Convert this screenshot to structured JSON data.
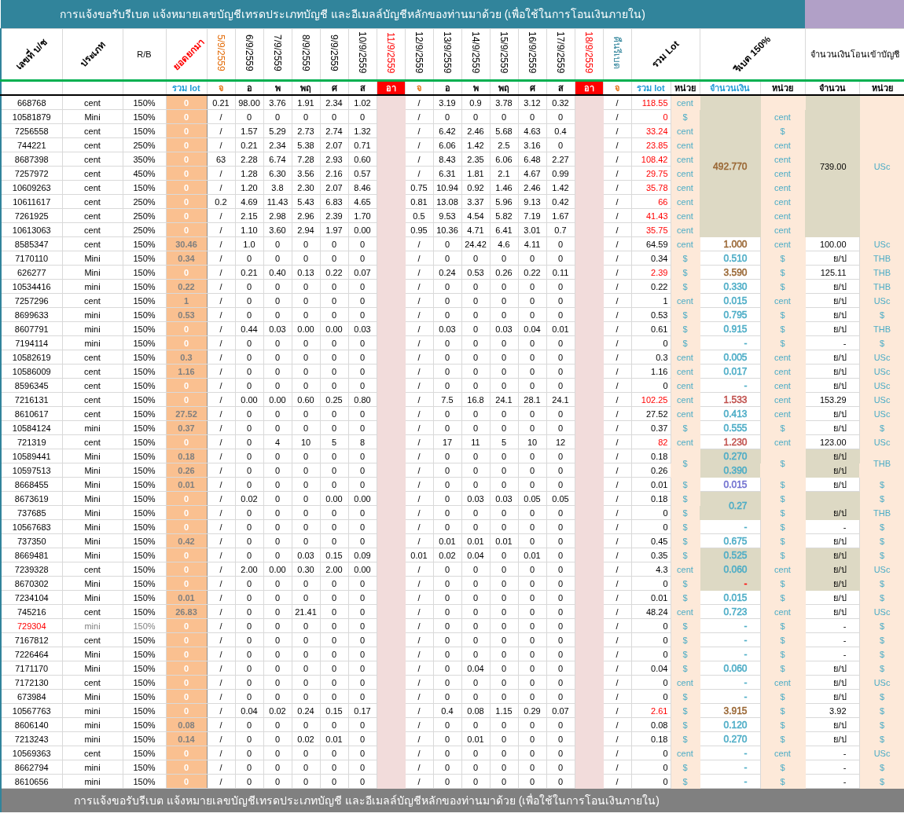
{
  "title": "การแจ้งขอรับรีเบต   แจ้งหมายเลขบัญชีเทรดประเภทบัญชี และอีเมลล์บัญชีหลักของท่านมาด้วย   (เพื่อใช้ในการโอนเงินภายใน)",
  "header_groups": [
    {
      "label": "เลขที่ บ/ช",
      "kind": "account",
      "holiday": false
    },
    {
      "label": "ประเภท",
      "kind": "type",
      "holiday": false
    },
    {
      "label": "R/B",
      "kind": "rb",
      "holiday": false
    },
    {
      "label": "ยอดยกมา",
      "kind": "carried",
      "color": "#ff0000",
      "holiday": false,
      "subs": [
        {
          "label": "รวม lot",
          "color": "#1f9ad6"
        }
      ]
    },
    {
      "label": "5/9/2559",
      "kind": "day",
      "color": "#e36c09",
      "holiday": false,
      "subs": [
        {
          "label": "จ",
          "color": "#e36c09"
        }
      ]
    },
    {
      "label": "6/9/2559",
      "kind": "day",
      "holiday": false,
      "subs": [
        {
          "label": "อ"
        }
      ]
    },
    {
      "label": "7/9/2559",
      "kind": "day",
      "holiday": false,
      "subs": [
        {
          "label": "พ"
        }
      ]
    },
    {
      "label": "8/9/2559",
      "kind": "day",
      "holiday": false,
      "subs": [
        {
          "label": "พฤ"
        }
      ]
    },
    {
      "label": "9/9/2559",
      "kind": "day",
      "holiday": false,
      "subs": [
        {
          "label": "ศ"
        }
      ]
    },
    {
      "label": "10/9/2559",
      "kind": "day",
      "holiday": false,
      "subs": [
        {
          "label": "ส"
        }
      ]
    },
    {
      "label": "11/9/2559",
      "kind": "day",
      "color": "#ff0000",
      "holiday": true,
      "subs": [
        {
          "label": "อา"
        }
      ]
    },
    {
      "label": "12/9/2559",
      "kind": "day",
      "holiday": false,
      "subs": [
        {
          "label": "จ",
          "color": "#e36c09"
        }
      ]
    },
    {
      "label": "13/9/2559",
      "kind": "day",
      "holiday": false,
      "subs": [
        {
          "label": "อ"
        }
      ]
    },
    {
      "label": "14/9/2559",
      "kind": "day",
      "holiday": false,
      "subs": [
        {
          "label": "พ"
        }
      ]
    },
    {
      "label": "15/9/2559",
      "kind": "day",
      "holiday": false,
      "subs": [
        {
          "label": "พฤ"
        }
      ]
    },
    {
      "label": "16/9/2559",
      "kind": "day",
      "holiday": false,
      "subs": [
        {
          "label": "ศ"
        }
      ]
    },
    {
      "label": "17/9/2559",
      "kind": "day",
      "holiday": false,
      "subs": [
        {
          "label": "ส"
        }
      ]
    },
    {
      "label": "18/9/2559",
      "kind": "day",
      "color": "#ff0000",
      "holiday": true,
      "subs": [
        {
          "label": "อา"
        }
      ]
    },
    {
      "label": "คืนรีเบต",
      "kind": "day",
      "color": "#31849b",
      "holiday": false,
      "subs": [
        {
          "label": "จ",
          "color": "#e36c09"
        }
      ]
    },
    {
      "label": "รวม Lot",
      "kind": "lot",
      "holiday": false,
      "subs": [
        {
          "label": "รวม lot",
          "color": "#1f9ad6"
        },
        {
          "label": "หน่วย"
        }
      ]
    },
    {
      "label": "รีเบต 150%",
      "kind": "rebate",
      "holiday": false,
      "subs": [
        {
          "label": "จำนวนเงิน",
          "color": "#1f9ad6"
        },
        {
          "label": "หน่วย"
        }
      ]
    },
    {
      "label": "จำนวนเงินโอนเข้าบัญชี",
      "kind": "transfer",
      "holiday": false,
      "subs": [
        {
          "label": "จำนวน"
        },
        {
          "label": "หน่วย"
        }
      ]
    }
  ],
  "rows": [
    {
      "kind": "group",
      "shaded": true,
      "amount": {
        "text": "492.770",
        "color": "#996633"
      },
      "transfer": "739.00",
      "transfer_unit": "USc",
      "rows": [
        {
          "account": "668768",
          "type": "cent",
          "rb": "150%",
          "carried": "0",
          "carried_faint": true,
          "flagged": false,
          "days": [
            "0.21",
            "98.00",
            "3.76",
            "1.91",
            "2.34",
            "1.02",
            "/",
            "3.19",
            "0.9",
            "3.78",
            "3.12",
            "0.32",
            "/"
          ],
          "total": "118.55",
          "total_alert": true,
          "lot_unit": "cent"
        },
        {
          "account": "10581879",
          "type": "Mini",
          "rb": "150%",
          "carried": "0",
          "carried_faint": true,
          "flagged": false,
          "days": [
            "/",
            "0",
            "0",
            "0",
            "0",
            "0",
            "/",
            "0",
            "0",
            "0",
            "0",
            "0",
            "/"
          ],
          "total": "0",
          "total_alert": true,
          "lot_unit": "$",
          "amount_unit": "cent"
        },
        {
          "account": "7256558",
          "type": "cent",
          "rb": "150%",
          "carried": "0",
          "carried_faint": true,
          "flagged": false,
          "days": [
            "/",
            "1.57",
            "5.29",
            "2.73",
            "2.74",
            "1.32",
            "/",
            "6.42",
            "2.46",
            "5.68",
            "4.63",
            "0.4",
            "/"
          ],
          "total": "33.24",
          "total_alert": true,
          "lot_unit": "cent",
          "amount_unit": "$"
        },
        {
          "account": "744221",
          "type": "cent",
          "rb": "250%",
          "carried": "0",
          "carried_faint": true,
          "flagged": false,
          "days": [
            "/",
            "0.21",
            "2.34",
            "5.38",
            "2.07",
            "0.71",
            "/",
            "6.06",
            "1.42",
            "2.5",
            "3.16",
            "0",
            "/"
          ],
          "total": "23.85",
          "total_alert": true,
          "lot_unit": "cent",
          "amount_unit": "cent"
        },
        {
          "account": "8687398",
          "type": "cent",
          "rb": "350%",
          "carried": "0",
          "carried_faint": true,
          "flagged": false,
          "days": [
            "63",
            "2.28",
            "6.74",
            "7.28",
            "2.93",
            "0.60",
            "/",
            "8.43",
            "2.35",
            "6.06",
            "6.48",
            "2.27",
            "/"
          ],
          "total": "108.42",
          "total_alert": true,
          "lot_unit": "cent",
          "amount_unit": "cent"
        },
        {
          "account": "7257972",
          "type": "cent",
          "rb": "450%",
          "carried": "0",
          "carried_faint": true,
          "flagged": false,
          "days": [
            "/",
            "1.28",
            "6.30",
            "3.56",
            "2.16",
            "0.57",
            "/",
            "6.31",
            "1.81",
            "2.1",
            "4.67",
            "0.99",
            "/"
          ],
          "total": "29.75",
          "total_alert": true,
          "lot_unit": "cent",
          "amount_unit": "cent"
        },
        {
          "account": "10609263",
          "type": "cent",
          "rb": "150%",
          "carried": "0",
          "carried_faint": true,
          "flagged": false,
          "days": [
            "/",
            "1.20",
            "3.8",
            "2.30",
            "2.07",
            "8.46",
            "0.75",
            "10.94",
            "0.92",
            "1.46",
            "2.46",
            "1.42",
            "/"
          ],
          "total": "35.78",
          "total_alert": true,
          "lot_unit": "cent",
          "amount_unit": "cent"
        },
        {
          "account": "10611617",
          "type": "cent",
          "rb": "250%",
          "carried": "0",
          "carried_faint": true,
          "flagged": false,
          "days": [
            "0.2",
            "4.69",
            "11.43",
            "5.43",
            "6.83",
            "4.65",
            "0.81",
            "13.08",
            "3.37",
            "5.96",
            "9.13",
            "0.42",
            "/"
          ],
          "total": "66",
          "total_alert": true,
          "lot_unit": "cent",
          "amount_unit": "cent"
        },
        {
          "account": "7261925",
          "type": "cent",
          "rb": "250%",
          "carried": "0",
          "carried_faint": true,
          "flagged": false,
          "days": [
            "/",
            "2.15",
            "2.98",
            "2.96",
            "2.39",
            "1.70",
            "0.5",
            "9.53",
            "4.54",
            "5.82",
            "7.19",
            "1.67",
            "/"
          ],
          "total": "41.43",
          "total_alert": true,
          "lot_unit": "cent",
          "amount_unit": "cent"
        },
        {
          "account": "10613063",
          "type": "cent",
          "rb": "250%",
          "carried": "0",
          "carried_faint": true,
          "flagged": false,
          "days": [
            "/",
            "1.10",
            "3.60",
            "2.94",
            "1.97",
            "0.00",
            "0.95",
            "10.36",
            "4.71",
            "6.41",
            "3.01",
            "0.7",
            "/"
          ],
          "total": "35.75",
          "total_alert": true,
          "lot_unit": "cent",
          "amount_unit": "cent"
        }
      ]
    },
    {
      "kind": "row",
      "account": "8585347",
      "type": "cent",
      "rb": "150%",
      "carried": "30.46",
      "carried_faint": false,
      "flagged": false,
      "days": [
        "/",
        "1.0",
        "0",
        "0",
        "0",
        "0",
        "/",
        "0",
        "24.42",
        "4.6",
        "4.11",
        "0",
        "/"
      ],
      "total": "64.59",
      "total_alert": false,
      "shaded": false,
      "lot_unit": "cent",
      "amount": {
        "text": "1.000",
        "color": "#996633"
      },
      "amount_unit": "cent",
      "transfer": "100.00",
      "transfer_unit": "USc"
    },
    {
      "kind": "row",
      "account": "7170110",
      "type": "Mini",
      "rb": "150%",
      "carried": "0.34",
      "carried_faint": false,
      "flagged": false,
      "days": [
        "/",
        "0",
        "0",
        "0",
        "0",
        "0",
        "/",
        "0",
        "0",
        "0",
        "0",
        "0",
        "/"
      ],
      "total": "0.34",
      "total_alert": false,
      "shaded": false,
      "lot_unit": "$",
      "amount": {
        "text": "0.510",
        "color": "#4bacc6"
      },
      "amount_unit": "$",
      "transfer": "ย/ป",
      "transfer_unit": "THB"
    },
    {
      "kind": "row",
      "account": "626277",
      "type": "Mini",
      "rb": "150%",
      "carried": "0",
      "carried_faint": true,
      "flagged": false,
      "days": [
        "/",
        "0.21",
        "0.40",
        "0.13",
        "0.22",
        "0.07",
        "/",
        "0.24",
        "0.53",
        "0.26",
        "0.22",
        "0.11",
        "/"
      ],
      "total": "2.39",
      "total_alert": true,
      "shaded": false,
      "lot_unit": "$",
      "amount": {
        "text": "3.590",
        "color": "#996633"
      },
      "amount_unit": "$",
      "transfer": "125.11",
      "transfer_unit": "THB"
    },
    {
      "kind": "row",
      "account": "10534416",
      "type": "mini",
      "rb": "150%",
      "carried": "0.22",
      "carried_faint": false,
      "flagged": false,
      "days": [
        "/",
        "0",
        "0",
        "0",
        "0",
        "0",
        "/",
        "0",
        "0",
        "0",
        "0",
        "0",
        "/"
      ],
      "total": "0.22",
      "total_alert": false,
      "shaded": false,
      "lot_unit": "$",
      "amount": {
        "text": "0.330",
        "color": "#4bacc6"
      },
      "amount_unit": "$",
      "transfer": "ย/ป",
      "transfer_unit": "THB"
    },
    {
      "kind": "row",
      "account": "7257296",
      "type": "cent",
      "rb": "150%",
      "carried": "1",
      "carried_faint": false,
      "flagged": false,
      "days": [
        "/",
        "0",
        "0",
        "0",
        "0",
        "0",
        "/",
        "0",
        "0",
        "0",
        "0",
        "0",
        "/"
      ],
      "total": "1",
      "total_alert": false,
      "shaded": false,
      "lot_unit": "cent",
      "amount": {
        "text": "0.015",
        "color": "#4bacc6"
      },
      "amount_unit": "cent",
      "transfer": "ย/ป",
      "transfer_unit": "USc"
    },
    {
      "kind": "row",
      "account": "8699633",
      "type": "mini",
      "rb": "150%",
      "carried": "0.53",
      "carried_faint": false,
      "flagged": false,
      "days": [
        "/",
        "0",
        "0",
        "0",
        "0",
        "0",
        "/",
        "0",
        "0",
        "0",
        "0",
        "0",
        "/"
      ],
      "total": "0.53",
      "total_alert": false,
      "shaded": false,
      "lot_unit": "$",
      "amount": {
        "text": "0.795",
        "color": "#4bacc6"
      },
      "amount_unit": "$",
      "transfer": "ย/ป",
      "transfer_unit": "$"
    },
    {
      "kind": "row",
      "account": "8607791",
      "type": "mini",
      "rb": "150%",
      "carried": "0",
      "carried_faint": true,
      "flagged": false,
      "days": [
        "/",
        "0.44",
        "0.03",
        "0.00",
        "0.00",
        "0.03",
        "/",
        "0.03",
        "0",
        "0.03",
        "0.04",
        "0.01",
        "/"
      ],
      "total": "0.61",
      "total_alert": false,
      "shaded": false,
      "lot_unit": "$",
      "amount": {
        "text": "0.915",
        "color": "#4bacc6"
      },
      "amount_unit": "$",
      "transfer": "ย/ป",
      "transfer_unit": "THB"
    },
    {
      "kind": "row",
      "account": "7194114",
      "type": "mini",
      "rb": "150%",
      "carried": "0",
      "carried_faint": true,
      "flagged": false,
      "days": [
        "/",
        "0",
        "0",
        "0",
        "0",
        "0",
        "/",
        "0",
        "0",
        "0",
        "0",
        "0",
        "/"
      ],
      "total": "0",
      "total_alert": false,
      "shaded": false,
      "lot_unit": "$",
      "amount": {
        "text": "-",
        "color": "#4bacc6"
      },
      "amount_unit": "$",
      "transfer": "-",
      "transfer_unit": "$"
    },
    {
      "kind": "row",
      "account": "10582619",
      "type": "cent",
      "rb": "150%",
      "carried": "0.3",
      "carried_faint": false,
      "flagged": false,
      "days": [
        "/",
        "0",
        "0",
        "0",
        "0",
        "0",
        "/",
        "0",
        "0",
        "0",
        "0",
        "0",
        "/"
      ],
      "total": "0.3",
      "total_alert": false,
      "shaded": false,
      "lot_unit": "cent",
      "amount": {
        "text": "0.005",
        "color": "#4bacc6"
      },
      "amount_unit": "cent",
      "transfer": "ย/ป",
      "transfer_unit": "USc"
    },
    {
      "kind": "row",
      "account": "10586009",
      "type": "cent",
      "rb": "150%",
      "carried": "1.16",
      "carried_faint": false,
      "flagged": false,
      "days": [
        "/",
        "0",
        "0",
        "0",
        "0",
        "0",
        "/",
        "0",
        "0",
        "0",
        "0",
        "0",
        "/"
      ],
      "total": "1.16",
      "total_alert": false,
      "shaded": false,
      "lot_unit": "cent",
      "amount": {
        "text": "0.017",
        "color": "#4bacc6"
      },
      "amount_unit": "cent",
      "transfer": "ย/ป",
      "transfer_unit": "USc"
    },
    {
      "kind": "row",
      "account": "8596345",
      "type": "cent",
      "rb": "150%",
      "carried": "0",
      "carried_faint": true,
      "flagged": false,
      "days": [
        "/",
        "0",
        "0",
        "0",
        "0",
        "0",
        "/",
        "0",
        "0",
        "0",
        "0",
        "0",
        "/"
      ],
      "total": "0",
      "total_alert": false,
      "shaded": false,
      "lot_unit": "cent",
      "amount": {
        "text": "-",
        "color": "#4bacc6"
      },
      "amount_unit": "cent",
      "transfer": "ย/ป",
      "transfer_unit": "USc"
    },
    {
      "kind": "row",
      "account": "7216131",
      "type": "cent",
      "rb": "150%",
      "carried": "0",
      "carried_faint": true,
      "flagged": false,
      "days": [
        "/",
        "0.00",
        "0.00",
        "0.60",
        "0.25",
        "0.80",
        "/",
        "7.5",
        "16.8",
        "24.1",
        "28.1",
        "24.1",
        "/"
      ],
      "total": "102.25",
      "total_alert": true,
      "shaded": false,
      "lot_unit": "cent",
      "amount": {
        "text": "1.533",
        "color": "#c0504d"
      },
      "amount_unit": "cent",
      "transfer": "153.29",
      "transfer_unit": "USc"
    },
    {
      "kind": "row",
      "account": "8610617",
      "type": "cent",
      "rb": "150%",
      "carried": "27.52",
      "carried_faint": false,
      "flagged": false,
      "days": [
        "/",
        "0",
        "0",
        "0",
        "0",
        "0",
        "/",
        "0",
        "0",
        "0",
        "0",
        "0",
        "/"
      ],
      "total": "27.52",
      "total_alert": false,
      "shaded": false,
      "lot_unit": "cent",
      "amount": {
        "text": "0.413",
        "color": "#4bacc6"
      },
      "amount_unit": "cent",
      "transfer": "ย/ป",
      "transfer_unit": "USc"
    },
    {
      "kind": "row",
      "account": "10584124",
      "type": "mini",
      "rb": "150%",
      "carried": "0.37",
      "carried_faint": false,
      "flagged": false,
      "days": [
        "/",
        "0",
        "0",
        "0",
        "0",
        "0",
        "/",
        "0",
        "0",
        "0",
        "0",
        "0",
        "/"
      ],
      "total": "0.37",
      "total_alert": false,
      "shaded": false,
      "lot_unit": "$",
      "amount": {
        "text": "0.555",
        "color": "#4bacc6"
      },
      "amount_unit": "$",
      "transfer": "ย/ป",
      "transfer_unit": "$"
    },
    {
      "kind": "row",
      "account": "721319",
      "type": "cent",
      "rb": "150%",
      "carried": "0",
      "carried_faint": true,
      "flagged": false,
      "days": [
        "/",
        "0",
        "4",
        "10",
        "5",
        "8",
        "/",
        "17",
        "11",
        "5",
        "10",
        "12",
        "/"
      ],
      "total": "82",
      "total_alert": true,
      "shaded": false,
      "lot_unit": "cent",
      "amount": {
        "text": "1.230",
        "color": "#c0504d"
      },
      "amount_unit": "cent",
      "transfer": "123.00",
      "transfer_unit": "USc"
    },
    {
      "kind": "group",
      "lot_unit": "$",
      "amount_unit": "$",
      "transfer_unit": "THB",
      "rows": [
        {
          "account": "10589441",
          "type": "Mini",
          "rb": "150%",
          "carried": "0.18",
          "carried_faint": false,
          "flagged": false,
          "days": [
            "/",
            "0",
            "0",
            "0",
            "0",
            "0",
            "/",
            "0",
            "0",
            "0",
            "0",
            "0",
            "/"
          ],
          "total": "0.18",
          "total_alert": false,
          "shaded": true,
          "amount": {
            "text": "0.270",
            "color": "#4bacc6"
          },
          "transfer": "ย/ป"
        },
        {
          "account": "10597513",
          "type": "Mini",
          "rb": "150%",
          "carried": "0.26",
          "carried_faint": false,
          "flagged": false,
          "days": [
            "/",
            "0",
            "0",
            "0",
            "0",
            "0",
            "/",
            "0",
            "0",
            "0",
            "0",
            "0",
            "/"
          ],
          "total": "0.26",
          "total_alert": false,
          "shaded": true,
          "amount": {
            "text": "0.390",
            "color": "#4bacc6"
          },
          "transfer": "ย/ป"
        }
      ]
    },
    {
      "kind": "row",
      "account": "8668455",
      "type": "Mini",
      "rb": "150%",
      "carried": "0.01",
      "carried_faint": false,
      "flagged": false,
      "days": [
        "/",
        "0",
        "0",
        "0",
        "0",
        "0",
        "/",
        "0",
        "0",
        "0",
        "0",
        "0",
        "/"
      ],
      "total": "0.01",
      "total_alert": false,
      "shaded": false,
      "lot_unit": "$",
      "amount": {
        "text": "0.015",
        "color": "#6f6fcf"
      },
      "amount_unit": "$",
      "transfer": "ย/ป",
      "transfer_unit": "$"
    },
    {
      "kind": "group",
      "shaded": true,
      "amount": {
        "text": "0.27",
        "color": "#4bacc6"
      },
      "rows": [
        {
          "account": "8673619",
          "type": "Mini",
          "rb": "150%",
          "carried": "0",
          "carried_faint": true,
          "flagged": false,
          "days": [
            "/",
            "0.02",
            "0",
            "0",
            "0.00",
            "0.00",
            "/",
            "0",
            "0.03",
            "0.03",
            "0.05",
            "0.05",
            "/"
          ],
          "total": "0.18",
          "total_alert": false,
          "shaded": true,
          "lot_unit": "$",
          "amount_unit": "$",
          "transfer_unit": "$"
        },
        {
          "account": "737685",
          "type": "Mini",
          "rb": "150%",
          "carried": "0",
          "carried_faint": true,
          "flagged": false,
          "days": [
            "/",
            "0",
            "0",
            "0",
            "0",
            "0",
            "/",
            "0",
            "0",
            "0",
            "0",
            "0",
            "/"
          ],
          "total": "0",
          "total_alert": false,
          "shaded": true,
          "lot_unit": "$",
          "amount_unit": "$",
          "transfer": "ย/ป",
          "transfer_unit": "THB"
        }
      ]
    },
    {
      "kind": "row",
      "account": "10567683",
      "type": "Mini",
      "rb": "150%",
      "carried": "0",
      "carried_faint": true,
      "flagged": false,
      "days": [
        "/",
        "0",
        "0",
        "0",
        "0",
        "0",
        "/",
        "0",
        "0",
        "0",
        "0",
        "0",
        "/"
      ],
      "total": "0",
      "total_alert": false,
      "shaded": false,
      "lot_unit": "$",
      "amount": {
        "text": "-",
        "color": "#4bacc6"
      },
      "amount_unit": "$",
      "transfer": "-",
      "transfer_unit": "$"
    },
    {
      "kind": "row",
      "account": "737350",
      "type": "Mini",
      "rb": "150%",
      "carried": "0.42",
      "carried_faint": false,
      "flagged": false,
      "days": [
        "/",
        "0",
        "0",
        "0",
        "0",
        "0",
        "/",
        "0.01",
        "0.01",
        "0.01",
        "0",
        "0",
        "/"
      ],
      "total": "0.45",
      "total_alert": false,
      "shaded": false,
      "lot_unit": "$",
      "amount": {
        "text": "0.675",
        "color": "#4bacc6"
      },
      "amount_unit": "$",
      "transfer": "ย/ป",
      "transfer_unit": "$"
    },
    {
      "kind": "row",
      "account": "8669481",
      "type": "Mini",
      "rb": "150%",
      "carried": "0",
      "carried_faint": true,
      "flagged": false,
      "days": [
        "/",
        "0",
        "0",
        "0.03",
        "0.15",
        "0.09",
        "0.01",
        "0.02",
        "0.04",
        "0",
        "0.01",
        "0",
        "/"
      ],
      "total": "0.35",
      "total_alert": false,
      "shaded": true,
      "lot_unit": "$",
      "amount": {
        "text": "0.525",
        "color": "#4bacc6"
      },
      "amount_unit": "$",
      "transfer": "ย/ป",
      "transfer_unit": "$"
    },
    {
      "kind": "row",
      "account": "7239328",
      "type": "cent",
      "rb": "150%",
      "carried": "0",
      "carried_faint": true,
      "flagged": false,
      "days": [
        "/",
        "2.00",
        "0.00",
        "0.30",
        "2.00",
        "0.00",
        "/",
        "0",
        "0",
        "0",
        "0",
        "0",
        "/"
      ],
      "total": "4.3",
      "total_alert": false,
      "shaded": true,
      "lot_unit": "cent",
      "amount": {
        "text": "0.060",
        "color": "#4bacc6"
      },
      "amount_unit": "cent",
      "transfer": "ย/ป",
      "transfer_unit": "USc"
    },
    {
      "kind": "row",
      "account": "8670302",
      "type": "Mini",
      "rb": "150%",
      "carried": "0",
      "carried_faint": true,
      "flagged": false,
      "days": [
        "/",
        "0",
        "0",
        "0",
        "0",
        "0",
        "/",
        "0",
        "0",
        "0",
        "0",
        "0",
        "/"
      ],
      "total": "0",
      "total_alert": false,
      "shaded": true,
      "lot_unit": "$",
      "amount": {
        "text": "-",
        "color": "#ff0000"
      },
      "amount_unit": "$",
      "transfer": "ย/ป",
      "transfer_unit": "$"
    },
    {
      "kind": "row",
      "account": "7234104",
      "type": "Mini",
      "rb": "150%",
      "carried": "0.01",
      "carried_faint": false,
      "flagged": false,
      "days": [
        "/",
        "0",
        "0",
        "0",
        "0",
        "0",
        "/",
        "0",
        "0",
        "0",
        "0",
        "0",
        "/"
      ],
      "total": "0.01",
      "total_alert": false,
      "shaded": false,
      "lot_unit": "$",
      "amount": {
        "text": "0.015",
        "color": "#4bacc6"
      },
      "amount_unit": "$",
      "transfer": "ย/ป",
      "transfer_unit": "$"
    },
    {
      "kind": "row",
      "account": "745216",
      "type": "cent",
      "rb": "150%",
      "carried": "26.83",
      "carried_faint": false,
      "flagged": false,
      "days": [
        "/",
        "0",
        "0",
        "21.41",
        "0",
        "0",
        "/",
        "0",
        "0",
        "0",
        "0",
        "0",
        "/"
      ],
      "total": "48.24",
      "total_alert": false,
      "shaded": false,
      "lot_unit": "cent",
      "amount": {
        "text": "0.723",
        "color": "#4bacc6"
      },
      "amount_unit": "cent",
      "transfer": "ย/ป",
      "transfer_unit": "USc"
    },
    {
      "kind": "row",
      "account": "729304",
      "type": "mini",
      "rb": "150%",
      "carried": "0",
      "carried_faint": true,
      "flagged": true,
      "days": [
        "/",
        "0",
        "0",
        "0",
        "0",
        "0",
        "/",
        "0",
        "0",
        "0",
        "0",
        "0",
        "/"
      ],
      "total": "0",
      "total_alert": false,
      "shaded": false,
      "lot_unit": "$",
      "amount": {
        "text": "-",
        "color": "#4bacc6"
      },
      "amount_unit": "$",
      "transfer": "-",
      "transfer_unit": "$"
    },
    {
      "kind": "row",
      "account": "7167812",
      "type": "cent",
      "rb": "150%",
      "carried": "0",
      "carried_faint": true,
      "flagged": false,
      "days": [
        "/",
        "0",
        "0",
        "0",
        "0",
        "0",
        "/",
        "0",
        "0",
        "0",
        "0",
        "0",
        "/"
      ],
      "total": "0",
      "total_alert": false,
      "shaded": false,
      "lot_unit": "$",
      "amount": {
        "text": "-",
        "color": "#4bacc6"
      },
      "amount_unit": "$",
      "transfer": "-",
      "transfer_unit": "$"
    },
    {
      "kind": "row",
      "account": "7226464",
      "type": "Mini",
      "rb": "150%",
      "carried": "0",
      "carried_faint": true,
      "flagged": false,
      "days": [
        "/",
        "0",
        "0",
        "0",
        "0",
        "0",
        "/",
        "0",
        "0",
        "0",
        "0",
        "0",
        "/"
      ],
      "total": "0",
      "total_alert": false,
      "shaded": false,
      "lot_unit": "$",
      "amount": {
        "text": "-",
        "color": "#4bacc6"
      },
      "amount_unit": "$",
      "transfer": "-",
      "transfer_unit": "$"
    },
    {
      "kind": "row",
      "account": "7171170",
      "type": "Mini",
      "rb": "150%",
      "carried": "0",
      "carried_faint": true,
      "flagged": false,
      "days": [
        "/",
        "0",
        "0",
        "0",
        "0",
        "0",
        "/",
        "0",
        "0.04",
        "0",
        "0",
        "0",
        "/"
      ],
      "total": "0.04",
      "total_alert": false,
      "shaded": false,
      "lot_unit": "$",
      "amount": {
        "text": "0.060",
        "color": "#4bacc6"
      },
      "amount_unit": "$",
      "transfer": "ย/ป",
      "transfer_unit": "$"
    },
    {
      "kind": "row",
      "account": "7172130",
      "type": "cent",
      "rb": "150%",
      "carried": "0",
      "carried_faint": true,
      "flagged": false,
      "days": [
        "/",
        "0",
        "0",
        "0",
        "0",
        "0",
        "/",
        "0",
        "0",
        "0",
        "0",
        "0",
        "/"
      ],
      "total": "0",
      "total_alert": false,
      "shaded": false,
      "lot_unit": "cent",
      "amount": {
        "text": "-",
        "color": "#4bacc6"
      },
      "amount_unit": "cent",
      "transfer": "ย/ป",
      "transfer_unit": "USc"
    },
    {
      "kind": "row",
      "account": "673984",
      "type": "Mini",
      "rb": "150%",
      "carried": "0",
      "carried_faint": true,
      "flagged": false,
      "days": [
        "/",
        "0",
        "0",
        "0",
        "0",
        "0",
        "/",
        "0",
        "0",
        "0",
        "0",
        "0",
        "/"
      ],
      "total": "0",
      "total_alert": false,
      "shaded": false,
      "lot_unit": "$",
      "amount": {
        "text": "-",
        "color": "#4bacc6"
      },
      "amount_unit": "$",
      "transfer": "ย/ป",
      "transfer_unit": "$"
    },
    {
      "kind": "row",
      "account": "10567763",
      "type": "mini",
      "rb": "150%",
      "carried": "0",
      "carried_faint": true,
      "flagged": false,
      "days": [
        "/",
        "0.04",
        "0.02",
        "0.24",
        "0.15",
        "0.17",
        "/",
        "0.4",
        "0.08",
        "1.15",
        "0.29",
        "0.07",
        "/"
      ],
      "total": "2.61",
      "total_alert": true,
      "shaded": false,
      "lot_unit": "$",
      "amount": {
        "text": "3.915",
        "color": "#996633"
      },
      "amount_unit": "$",
      "transfer": "3.92",
      "transfer_unit": "$"
    },
    {
      "kind": "row",
      "account": "8606140",
      "type": "mini",
      "rb": "150%",
      "carried": "0.08",
      "carried_faint": false,
      "flagged": false,
      "days": [
        "/",
        "0",
        "0",
        "0",
        "0",
        "0",
        "/",
        "0",
        "0",
        "0",
        "0",
        "0",
        "/"
      ],
      "total": "0.08",
      "total_alert": false,
      "shaded": false,
      "lot_unit": "$",
      "amount": {
        "text": "0.120",
        "color": "#4bacc6"
      },
      "amount_unit": "$",
      "transfer": "ย/ป",
      "transfer_unit": "$"
    },
    {
      "kind": "row",
      "account": "7213243",
      "type": "mini",
      "rb": "150%",
      "carried": "0.14",
      "carried_faint": false,
      "flagged": false,
      "days": [
        "/",
        "0",
        "0",
        "0.02",
        "0.01",
        "0",
        "/",
        "0",
        "0.01",
        "0",
        "0",
        "0",
        "/"
      ],
      "total": "0.18",
      "total_alert": false,
      "shaded": false,
      "lot_unit": "$",
      "amount": {
        "text": "0.270",
        "color": "#4bacc6"
      },
      "amount_unit": "$",
      "transfer": "ย/ป",
      "transfer_unit": "$"
    },
    {
      "kind": "row",
      "account": "10569363",
      "type": "cent",
      "rb": "150%",
      "carried": "0",
      "carried_faint": true,
      "flagged": false,
      "days": [
        "/",
        "0",
        "0",
        "0",
        "0",
        "0",
        "/",
        "0",
        "0",
        "0",
        "0",
        "0",
        "/"
      ],
      "total": "0",
      "total_alert": false,
      "shaded": false,
      "lot_unit": "cent",
      "amount": {
        "text": "-",
        "color": "#4bacc6"
      },
      "amount_unit": "cent",
      "transfer": "-",
      "transfer_unit": "USc"
    },
    {
      "kind": "row",
      "account": "8662794",
      "type": "mini",
      "rb": "150%",
      "carried": "0",
      "carried_faint": true,
      "flagged": false,
      "days": [
        "/",
        "0",
        "0",
        "0",
        "0",
        "0",
        "/",
        "0",
        "0",
        "0",
        "0",
        "0",
        "/"
      ],
      "total": "0",
      "total_alert": false,
      "shaded": false,
      "lot_unit": "$",
      "amount": {
        "text": "-",
        "color": "#4bacc6"
      },
      "amount_unit": "$",
      "transfer": "-",
      "transfer_unit": "$"
    },
    {
      "kind": "row",
      "account": "8610656",
      "type": "mini",
      "rb": "150%",
      "carried": "0",
      "carried_faint": true,
      "flagged": false,
      "days": [
        "/",
        "0",
        "0",
        "0",
        "0",
        "0",
        "/",
        "0",
        "0",
        "0",
        "0",
        "0",
        "/"
      ],
      "total": "0",
      "total_alert": false,
      "shaded": false,
      "lot_unit": "$",
      "amount": {
        "text": "-",
        "color": "#4bacc6"
      },
      "amount_unit": "$",
      "transfer": "-",
      "transfer_unit": "$"
    }
  ],
  "footer": "การแจ้งขอรับรีเบต   แจ้งหมายเลขบัญชีเทรดประเภทบัญชี และอีเมลล์บัญชีหลักของท่านมาด้วย   (เพื่อใช้ในการโอนเงินภายใน)"
}
